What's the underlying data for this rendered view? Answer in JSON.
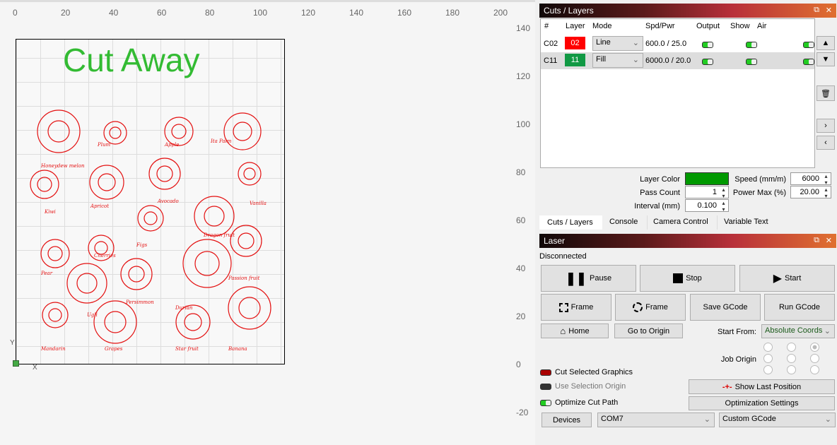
{
  "canvas": {
    "ruler_x": [
      "0",
      "20",
      "40",
      "60",
      "80",
      "100",
      "120",
      "140",
      "160",
      "180",
      "200"
    ],
    "ruler_y": [
      "140",
      "120",
      "100",
      "80",
      "60",
      "40",
      "20",
      "0",
      "-20"
    ],
    "axis_x": "X",
    "axis_y": "Y",
    "artwork_title": "Cut Away",
    "fruit_labels": [
      "Honeydew melon",
      "Plum",
      "Apple",
      "Ita Palm",
      "Kiwi",
      "Apricot",
      "Avocado",
      "Vanilla",
      "Dragon fruit",
      "Figs",
      "Pear",
      "Cherries",
      "Passion fruit",
      "Ugli",
      "Persimmon",
      "Durian",
      "Mandarin",
      "Grapes",
      "Star fruit",
      "Banana"
    ],
    "artwork_color": "#e41010",
    "title_color": "#33bb33"
  },
  "cuts": {
    "title": "Cuts / Layers",
    "headers": [
      "#",
      "Layer",
      "Mode",
      "Spd/Pwr",
      "Output",
      "Show",
      "Air"
    ],
    "rows": [
      {
        "id": "C02",
        "layer": "02",
        "color": "#ff0000",
        "mode": "Line",
        "spdpwr": "600.0 / 25.0",
        "output": true,
        "show": true,
        "air": true
      },
      {
        "id": "C11",
        "layer": "11",
        "color": "#119944",
        "mode": "Fill",
        "spdpwr": "6000.0 / 20.0",
        "output": true,
        "show": true,
        "air": true
      }
    ],
    "layer_color_label": "Layer Color",
    "layer_color": "#009900",
    "speed_label": "Speed (mm/m)",
    "speed": "6000",
    "pass_label": "Pass Count",
    "pass": "1",
    "power_label": "Power Max (%)",
    "power": "20.00",
    "interval_label": "Interval (mm)",
    "interval": "0.100"
  },
  "tabs": [
    "Cuts / Layers",
    "Console",
    "Camera Control",
    "Variable Text"
  ],
  "laser": {
    "title": "Laser",
    "status": "Disconnected",
    "pause": "Pause",
    "stop": "Stop",
    "start": "Start",
    "frame1": "Frame",
    "frame2": "Frame",
    "save_gcode": "Save GCode",
    "run_gcode": "Run GCode",
    "home": "Home",
    "go_origin": "Go to Origin",
    "start_from_label": "Start From:",
    "start_from": "Absolute Coords",
    "job_origin_label": "Job Origin",
    "cut_selected": "Cut Selected Graphics",
    "use_selection": "Use Selection Origin",
    "optimize": "Optimize Cut Path",
    "show_last": "Show Last Position",
    "opt_settings": "Optimization Settings",
    "devices": "Devices",
    "port": "COM7",
    "device": "Custom GCode"
  }
}
